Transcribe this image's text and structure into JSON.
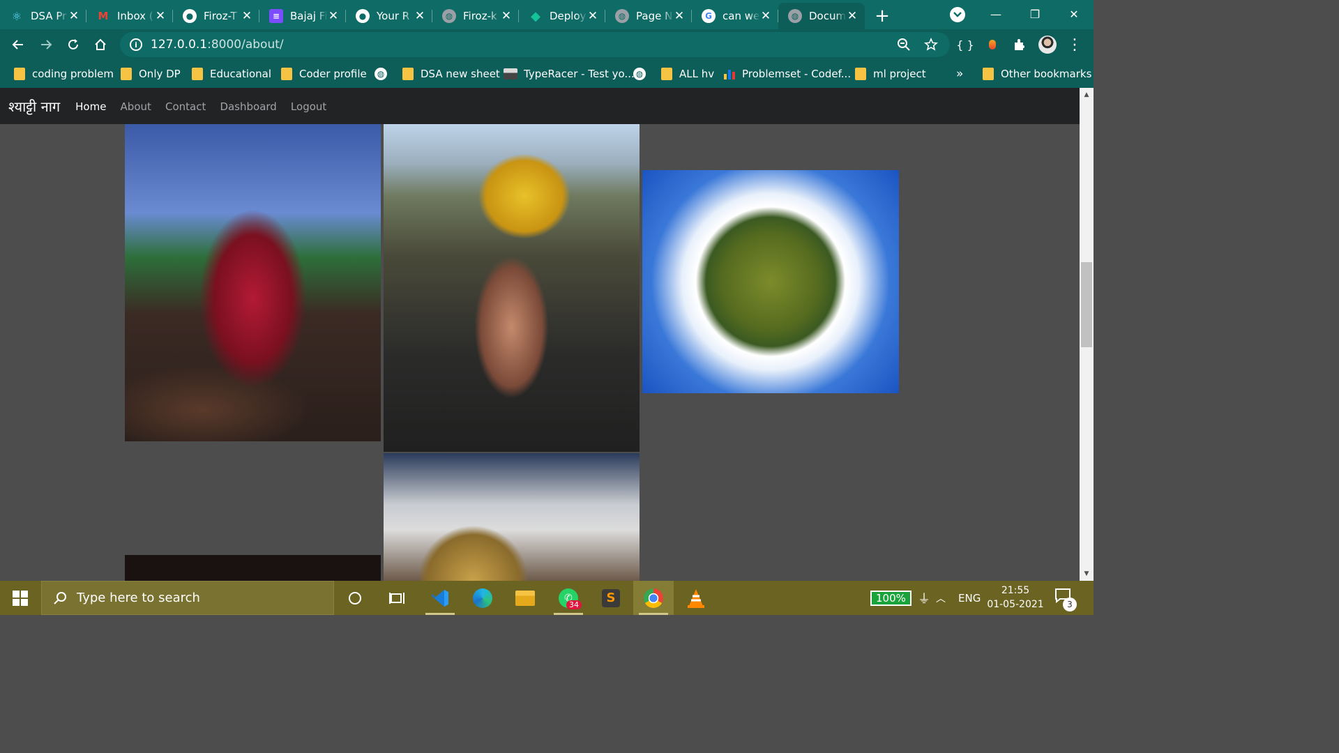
{
  "browser": {
    "tabs": [
      {
        "title": "DSA Pr",
        "icon": "react-icon",
        "color": "#61dafb"
      },
      {
        "title": "Inbox (",
        "icon": "gmail-icon",
        "color": "#ea4335"
      },
      {
        "title": "Firoz-T",
        "icon": "github-icon",
        "color": "#ffffff"
      },
      {
        "title": "Bajaj Fi",
        "icon": "forms-icon",
        "color": "#7c4dff"
      },
      {
        "title": "Your R",
        "icon": "github-icon",
        "color": "#ffffff"
      },
      {
        "title": "Firoz-k",
        "icon": "globe-icon",
        "color": "#9aa0a6"
      },
      {
        "title": "Deploy",
        "icon": "netlify-icon",
        "color": "#15c39a"
      },
      {
        "title": "Page N",
        "icon": "globe-icon",
        "color": "#9aa0a6"
      },
      {
        "title": "can we",
        "icon": "google-icon",
        "color": "#4285f4"
      },
      {
        "title": "Docum",
        "icon": "globe-icon",
        "color": "#9aa0a6",
        "active": true
      }
    ],
    "address": {
      "host": "127.0.0.1",
      "path": ":8000/about/"
    },
    "bookmarks": [
      {
        "label": "coding problem",
        "type": "folder"
      },
      {
        "label": "Only DP",
        "type": "folder"
      },
      {
        "label": "Educational",
        "type": "folder"
      },
      {
        "label": "Coder profile",
        "type": "folder"
      },
      {
        "label": "",
        "type": "globe"
      },
      {
        "label": "DSA new sheet",
        "type": "folder"
      },
      {
        "label": "TypeRacer - Test yo...",
        "type": "site"
      },
      {
        "label": "",
        "type": "globe"
      },
      {
        "label": "ALL hv",
        "type": "folder"
      },
      {
        "label": "Problemset - Codef...",
        "type": "site"
      },
      {
        "label": "ml project",
        "type": "folder"
      },
      {
        "label": "»",
        "type": "more"
      },
      {
        "label": "Other bookmarks",
        "type": "folder"
      }
    ]
  },
  "site": {
    "brand": "श्याट्टी नाग",
    "nav": [
      "Home",
      "About",
      "Contact",
      "Dashboard",
      "Logout"
    ]
  },
  "taskbar": {
    "search_placeholder": "Type here to search",
    "battery": "100%",
    "language": "ENG",
    "time": "21:55",
    "date": "01-05-2021",
    "notifications": "3",
    "whatsapp_badge": "34"
  }
}
